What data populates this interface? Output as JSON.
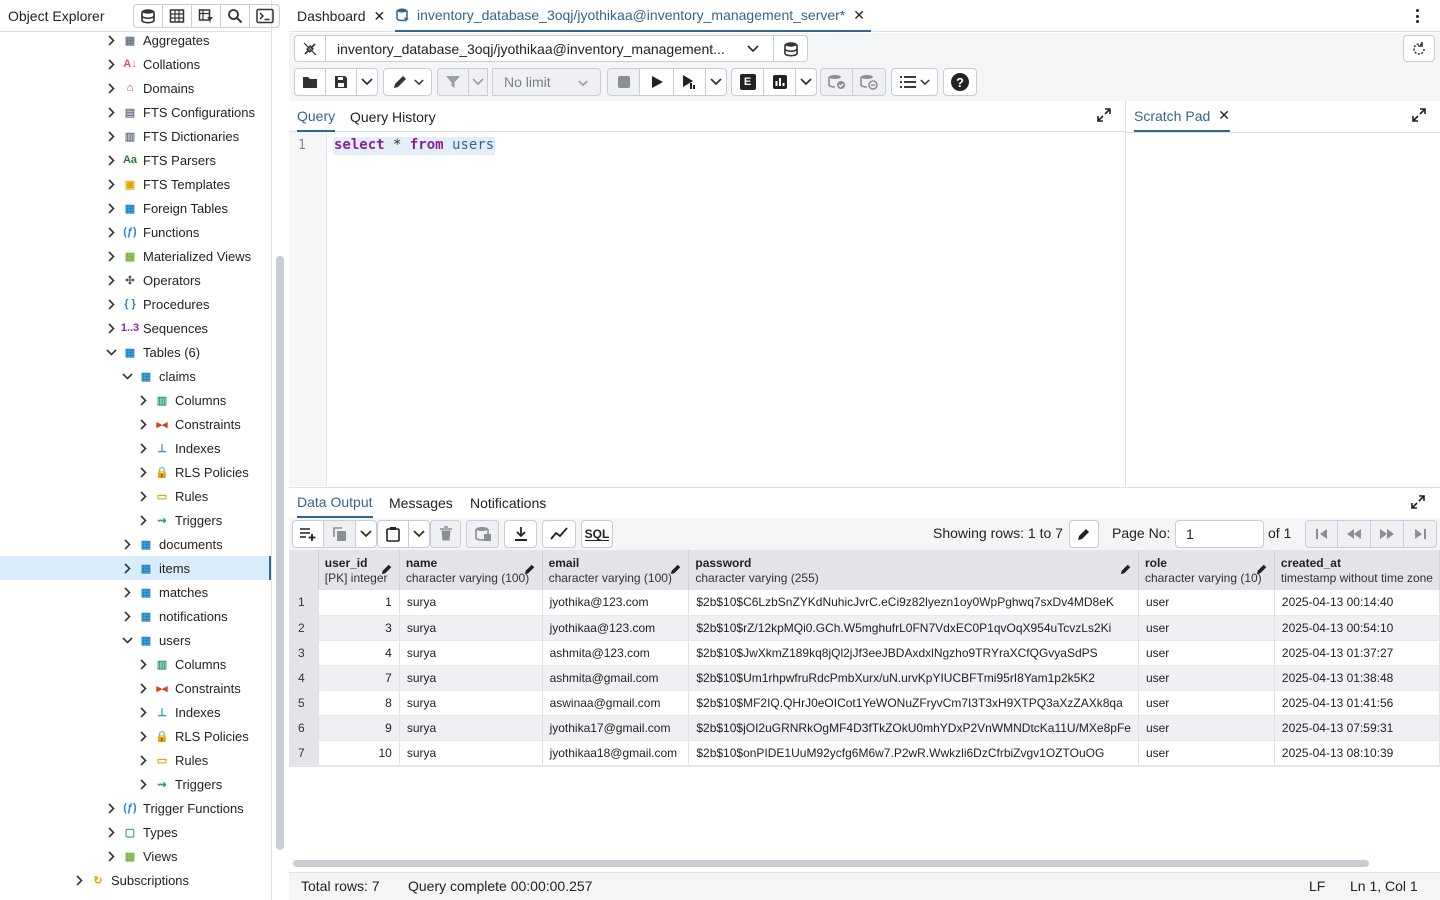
{
  "left_panel": {
    "title": "Object Explorer",
    "tree": [
      {
        "label": "Aggregates",
        "level": 1,
        "state": "collapsed",
        "icon": "aggregates-icon",
        "color": "#6b7a89"
      },
      {
        "label": "Collations",
        "level": 1,
        "state": "collapsed",
        "icon": "collations-icon",
        "color": "#d9534f"
      },
      {
        "label": "Domains",
        "level": 1,
        "state": "collapsed",
        "icon": "domains-icon",
        "color": "#c0392b"
      },
      {
        "label": "FTS Configurations",
        "level": 1,
        "state": "collapsed",
        "icon": "fts-config-icon",
        "color": "#6b7a89"
      },
      {
        "label": "FTS Dictionaries",
        "level": 1,
        "state": "collapsed",
        "icon": "fts-dict-icon",
        "color": "#6b7a89"
      },
      {
        "label": "FTS Parsers",
        "level": 1,
        "state": "collapsed",
        "icon": "fts-parser-icon",
        "color": "#2e7d32"
      },
      {
        "label": "FTS Templates",
        "level": 1,
        "state": "collapsed",
        "icon": "fts-template-icon",
        "color": "#e0a800"
      },
      {
        "label": "Foreign Tables",
        "level": 1,
        "state": "collapsed",
        "icon": "foreign-table-icon",
        "color": "#1e88c7"
      },
      {
        "label": "Functions",
        "level": 1,
        "state": "collapsed",
        "icon": "functions-icon",
        "color": "#1e88c7"
      },
      {
        "label": "Materialized Views",
        "level": 1,
        "state": "collapsed",
        "icon": "mat-view-icon",
        "color": "#7cb342"
      },
      {
        "label": "Operators",
        "level": 1,
        "state": "collapsed",
        "icon": "operators-icon",
        "color": "#555"
      },
      {
        "label": "Procedures",
        "level": 1,
        "state": "collapsed",
        "icon": "procedures-icon",
        "color": "#1e88c7"
      },
      {
        "label": "Sequences",
        "level": 1,
        "state": "collapsed",
        "icon": "sequences-icon",
        "color": "#8e24aa"
      },
      {
        "label": "Tables (6)",
        "level": 1,
        "state": "expanded",
        "icon": "tables-icon",
        "color": "#1e88c7"
      },
      {
        "label": "claims",
        "level": 2,
        "state": "expanded",
        "icon": "table-icon",
        "color": "#1e88c7"
      },
      {
        "label": "Columns",
        "level": 3,
        "state": "collapsed",
        "icon": "columns-icon",
        "color": "#2e9e6b"
      },
      {
        "label": "Constraints",
        "level": 3,
        "state": "collapsed",
        "icon": "constraints-icon",
        "color": "#d84315"
      },
      {
        "label": "Indexes",
        "level": 3,
        "state": "collapsed",
        "icon": "indexes-icon",
        "color": "#1e88c7"
      },
      {
        "label": "RLS Policies",
        "level": 3,
        "state": "collapsed",
        "icon": "rls-icon",
        "color": "#2e7d32"
      },
      {
        "label": "Rules",
        "level": 3,
        "state": "collapsed",
        "icon": "rules-icon",
        "color": "#e0a800"
      },
      {
        "label": "Triggers",
        "level": 3,
        "state": "collapsed",
        "icon": "triggers-icon",
        "color": "#1e9c8a"
      },
      {
        "label": "documents",
        "level": 2,
        "state": "collapsed",
        "icon": "table-icon",
        "color": "#1e88c7"
      },
      {
        "label": "items",
        "level": 2,
        "state": "collapsed",
        "icon": "table-icon",
        "color": "#1e88c7",
        "selected": true
      },
      {
        "label": "matches",
        "level": 2,
        "state": "collapsed",
        "icon": "table-icon",
        "color": "#1e88c7"
      },
      {
        "label": "notifications",
        "level": 2,
        "state": "collapsed",
        "icon": "table-icon",
        "color": "#1e88c7"
      },
      {
        "label": "users",
        "level": 2,
        "state": "expanded",
        "icon": "table-icon",
        "color": "#1e88c7"
      },
      {
        "label": "Columns",
        "level": 3,
        "state": "collapsed",
        "icon": "columns-icon",
        "color": "#2e9e6b"
      },
      {
        "label": "Constraints",
        "level": 3,
        "state": "collapsed",
        "icon": "constraints-icon",
        "color": "#d84315"
      },
      {
        "label": "Indexes",
        "level": 3,
        "state": "collapsed",
        "icon": "indexes-icon",
        "color": "#1e88c7"
      },
      {
        "label": "RLS Policies",
        "level": 3,
        "state": "collapsed",
        "icon": "rls-icon",
        "color": "#2e7d32"
      },
      {
        "label": "Rules",
        "level": 3,
        "state": "collapsed",
        "icon": "rules-icon",
        "color": "#e0a800"
      },
      {
        "label": "Triggers",
        "level": 3,
        "state": "collapsed",
        "icon": "triggers-icon",
        "color": "#1e9c8a"
      },
      {
        "label": "Trigger Functions",
        "level": 1,
        "state": "collapsed",
        "icon": "trigger-functions-icon",
        "color": "#1e88c7"
      },
      {
        "label": "Types",
        "level": 1,
        "state": "collapsed",
        "icon": "types-icon",
        "color": "#2e9e6b"
      },
      {
        "label": "Views",
        "level": 1,
        "state": "collapsed",
        "icon": "views-icon",
        "color": "#7cb342"
      },
      {
        "label": "Subscriptions",
        "level": 0,
        "state": "collapsed",
        "icon": "subscriptions-icon",
        "color": "#e0a800"
      }
    ]
  },
  "tabs": [
    {
      "label": "Dashboard",
      "active": false
    },
    {
      "label": "inventory_database_3oqj/jyothikaa@inventory_management_server*",
      "active": true
    }
  ],
  "toolbar": {
    "connection": "inventory_database_3oqj/jyothikaa@inventory_management...",
    "limit": "No limit"
  },
  "query_tabs": {
    "query": "Query",
    "history": "Query History"
  },
  "editor": {
    "line_number": "1",
    "kw1": "select",
    "star": " * ",
    "kw2": "from",
    "table": "users"
  },
  "scratch_pad": {
    "title": "Scratch Pad"
  },
  "output_tabs": {
    "data_output": "Data Output",
    "messages": "Messages",
    "notifications": "Notifications"
  },
  "grid_toolbar": {
    "sql_label": "SQL",
    "showing_rows": "Showing rows: 1 to 7",
    "page_no_label": "Page No:",
    "page_no": "1",
    "of_pages": "of 1"
  },
  "result": {
    "columns": [
      {
        "name": "user_id",
        "type": "[PK] integer"
      },
      {
        "name": "name",
        "type": "character varying (100)"
      },
      {
        "name": "email",
        "type": "character varying (100)"
      },
      {
        "name": "password",
        "type": "character varying (255)"
      },
      {
        "name": "role",
        "type": "character varying (10)"
      },
      {
        "name": "created_at",
        "type": "timestamp without time zone"
      }
    ],
    "rows": [
      {
        "n": "1",
        "user_id": "1",
        "name": "surya",
        "email": "jyothika@123.com",
        "password": "$2b$10$C6LzbSnZYKdNuhicJvrC.eCi9z82lyezn1oy0WpPghwq7sxDv4MD8eK",
        "role": "user",
        "created_at": "2025-04-13 00:14:40"
      },
      {
        "n": "2",
        "user_id": "3",
        "name": "surya",
        "email": "jyothikaa@123.com",
        "password": "$2b$10$rZ/12kpMQi0.GCh.W5mghufrL0FN7VdxEC0P1qvOqX954uTcvzLs2Ki",
        "role": "user",
        "created_at": "2025-04-13 00:54:10"
      },
      {
        "n": "3",
        "user_id": "4",
        "name": "surya",
        "email": "ashmita@123.com",
        "password": "$2b$10$JwXkmZ189kq8jQl2jJf3eeJBDAxdxlNgzho9TRYraXCfQGvyaSdPS",
        "role": "user",
        "created_at": "2025-04-13 01:37:27"
      },
      {
        "n": "4",
        "user_id": "7",
        "name": "surya",
        "email": "ashmita@gmail.com",
        "password": "$2b$10$Um1rhpwfruRdcPmbXurx/uN.urvKpYIUCBFTmi95rI8Yam1p2k5K2",
        "role": "user",
        "created_at": "2025-04-13 01:38:48"
      },
      {
        "n": "5",
        "user_id": "8",
        "name": "surya",
        "email": "aswinaa@gmail.com",
        "password": "$2b$10$MF2IQ.QHrJ0eOICot1YeWONuZFryvCm7I3T3xH9XTPQ3aXzZAXk8qa",
        "role": "user",
        "created_at": "2025-04-13 01:41:56"
      },
      {
        "n": "6",
        "user_id": "9",
        "name": "surya",
        "email": "jyothika17@gmail.com",
        "password": "$2b$10$jOI2uGRNRkOgMF4D3fTkZOkU0mhYDxP2VnWMNDtcKa11U/MXe8pFe",
        "role": "user",
        "created_at": "2025-04-13 07:59:31"
      },
      {
        "n": "7",
        "user_id": "10",
        "name": "surya",
        "email": "jyothikaa18@gmail.com",
        "password": "$2b$10$onPIDE1UuM92ycfg6M6w7.P2wR.Wwkzli6DzCfrbiZvgv1OZTOuOG",
        "role": "user",
        "created_at": "2025-04-13 08:10:39"
      }
    ]
  },
  "status": {
    "total_rows": "Total rows: 7",
    "query_complete": "Query complete 00:00:00.257",
    "line_ending": "LF",
    "cursor": "Ln 1, Col 1"
  }
}
